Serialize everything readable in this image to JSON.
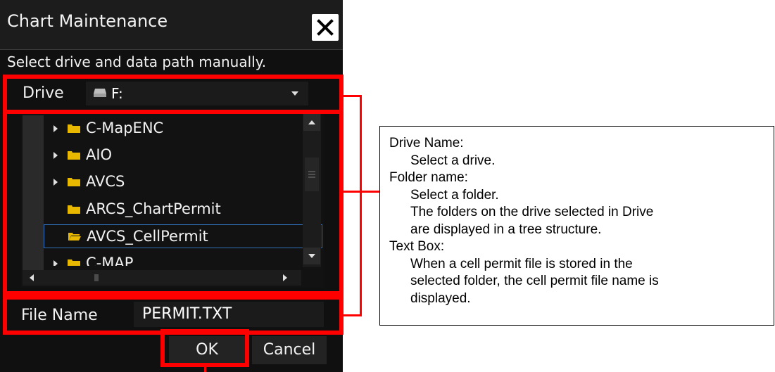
{
  "dialog": {
    "title": "Chart Maintenance",
    "instruction": "Select drive and data path manually.",
    "drive_label": "Drive",
    "drive_value": "F:",
    "tree_items": [
      {
        "label": "C-MapENC",
        "expandable": true,
        "selected": false
      },
      {
        "label": "AIO",
        "expandable": true,
        "selected": false
      },
      {
        "label": "AVCS",
        "expandable": true,
        "selected": false
      },
      {
        "label": "ARCS_ChartPermit",
        "expandable": false,
        "selected": false
      },
      {
        "label": "AVCS_CellPermit",
        "expandable": false,
        "selected": true
      },
      {
        "label": "C-MAP",
        "expandable": true,
        "selected": false
      }
    ],
    "file_name_label": "File Name",
    "file_name_value": "PERMIT.TXT",
    "ok_label": "OK",
    "cancel_label": "Cancel"
  },
  "callout": {
    "lines": [
      "Drive Name:",
      "Select a drive.",
      "Folder name:",
      "Select a folder.",
      "The folders on the drive selected in Drive",
      "are displayed in a tree structure.",
      "Text Box:",
      "When a cell permit file is stored in the",
      "selected folder, the cell permit file name is",
      "displayed."
    ]
  },
  "colors": {
    "highlight": "#ff0000",
    "folder": "#e8b800",
    "selection_border": "#2f6fb8"
  }
}
